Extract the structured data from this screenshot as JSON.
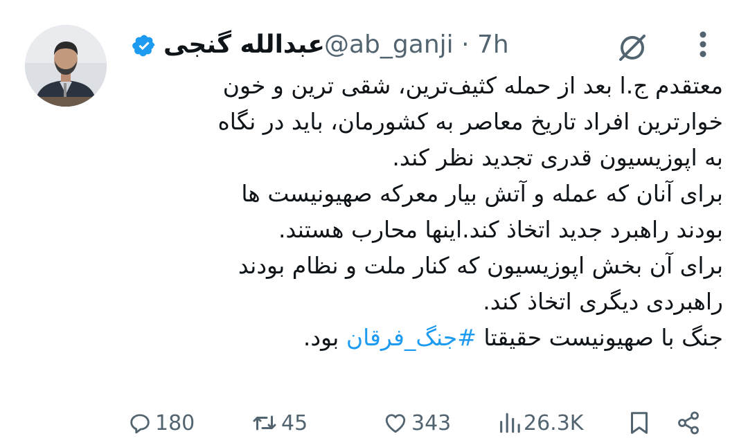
{
  "author": {
    "display_name": "عبدالله گنجی",
    "handle": "@ab_ganji",
    "separator": "·",
    "time": "7h",
    "verified": true
  },
  "tweet": {
    "lines": [
      "معتقدم ج.ا بعد از حمله کثیف‌ترین، شقی ترین و خون",
      "خوارترین افراد تاریخ معاصر به کشورمان، باید در نگاه",
      "به اپوزیسیون قدری تجدید نظر کند.",
      "برای آنان که عمله و آتش بیار معرکه صهیونیست ها",
      "بودند راهبرد جدید اتخاذ کند.اینها محارب هستند.",
      "برای آن بخش اپوزیسیون که کنار ملت و نظام بودند",
      "راهبردی دیگری اتخاذ کند."
    ],
    "last_line_before": "جنگ با صهیونیست حقیقتا ",
    "hashtag": "#جنگ_فرقان",
    "last_line_after": " بود."
  },
  "actions": {
    "replies": "180",
    "retweets": "45",
    "likes": "343",
    "views": "26.3K"
  },
  "colors": {
    "text": "#0f1419",
    "muted": "#536471",
    "link": "#1d9bf0",
    "verified": "#1d9bf0"
  },
  "icons": [
    "verified-badge-icon",
    "grok-icon",
    "more-icon",
    "reply-icon",
    "retweet-icon",
    "like-icon",
    "views-icon",
    "bookmark-icon",
    "share-icon"
  ]
}
